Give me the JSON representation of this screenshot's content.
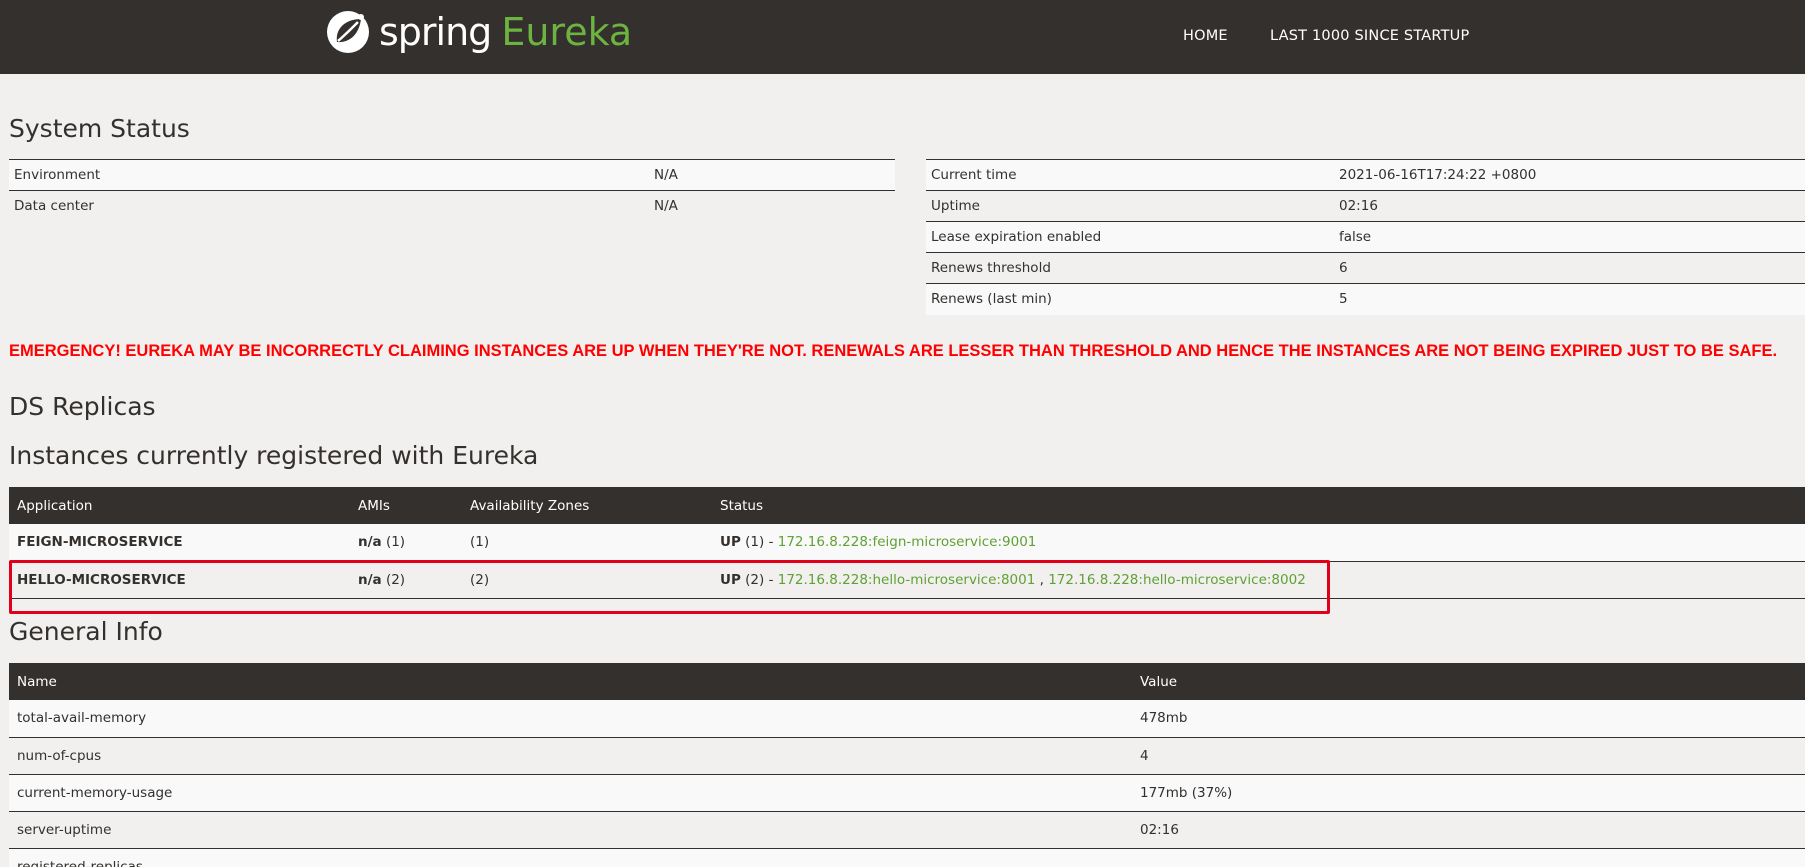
{
  "nav": {
    "brand_spring": "spring",
    "brand_eureka": "Eureka",
    "home": "HOME",
    "last_1000": "LAST 1000 SINCE STARTUP"
  },
  "colors": {
    "navbar_bg": "#34302d",
    "accent_green": "#6db33f",
    "emergency_red": "#ff0000",
    "highlight_box": "#e0001a"
  },
  "system_status": {
    "title": "System Status",
    "left": [
      {
        "key": "Environment",
        "value": "N/A"
      },
      {
        "key": "Data center",
        "value": "N/A"
      }
    ],
    "right": [
      {
        "key": "Current time",
        "value": "2021-06-16T17:24:22 +0800"
      },
      {
        "key": "Uptime",
        "value": "02:16"
      },
      {
        "key": "Lease expiration enabled",
        "value": "false"
      },
      {
        "key": "Renews threshold",
        "value": "6"
      },
      {
        "key": "Renews (last min)",
        "value": "5"
      }
    ]
  },
  "emergency": "EMERGENCY! EUREKA MAY BE INCORRECTLY CLAIMING INSTANCES ARE UP WHEN THEY'RE NOT. RENEWALS ARE LESSER THAN THRESHOLD AND HENCE THE INSTANCES ARE NOT BEING EXPIRED JUST TO BE SAFE.",
  "ds_replicas": {
    "title": "DS Replicas"
  },
  "instances": {
    "title": "Instances currently registered with Eureka",
    "headers": [
      "Application",
      "AMIs",
      "Availability Zones",
      "Status"
    ],
    "rows": [
      {
        "application": "FEIGN-MICROSERVICE",
        "ami_label": "n/a",
        "ami_count": "(1)",
        "zones": "(1)",
        "status": "UP",
        "status_count": "(1) -",
        "links": [
          "172.16.8.228:feign-microservice:9001"
        ]
      },
      {
        "application": "HELLO-MICROSERVICE",
        "ami_label": "n/a",
        "ami_count": "(2)",
        "zones": "(2)",
        "status": "UP",
        "status_count": "(2) -",
        "links": [
          "172.16.8.228:hello-microservice:8001",
          "172.16.8.228:hello-microservice:8002"
        ],
        "link_separator": ","
      }
    ]
  },
  "general_info": {
    "title": "General Info",
    "headers": [
      "Name",
      "Value"
    ],
    "rows": [
      {
        "name": "total-avail-memory",
        "value": "478mb"
      },
      {
        "name": "num-of-cpus",
        "value": "4"
      },
      {
        "name": "current-memory-usage",
        "value": "177mb (37%)"
      },
      {
        "name": "server-uptime",
        "value": "02:16"
      },
      {
        "name": "registered-replicas",
        "value": ""
      }
    ]
  }
}
